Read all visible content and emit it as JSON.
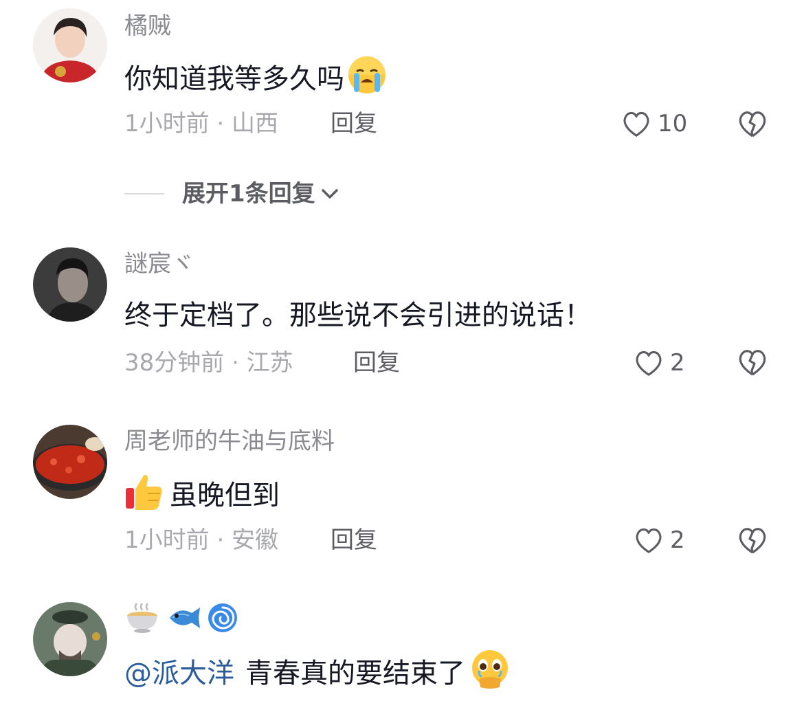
{
  "comments": [
    {
      "username": "橘贼",
      "content": "你知道我等多久吗",
      "content_emoji": "loudly-crying-face",
      "time": "1小时前",
      "location": "山西",
      "meta": "1小时前 · 山西",
      "reply_label": "回复",
      "likes": "10",
      "expand_label": "展开1条回复"
    },
    {
      "username": "謎宸ヾ",
      "content": "终于定档了。那些说不会引进的说话！",
      "time": "38分钟前",
      "location": "江苏",
      "meta": "38分钟前 · 江苏",
      "reply_label": "回复",
      "likes": "2"
    },
    {
      "username": "周老师的牛油与底料",
      "content_emoji": "thumbs-up",
      "content": "虽晚但到",
      "time": "1小时前",
      "location": "安徽",
      "meta": "1小时前 · 安徽",
      "reply_label": "回复",
      "likes": "2"
    },
    {
      "username_emojis": [
        "soup-bowl",
        "fish",
        "cyclone"
      ],
      "mention": "@派大洋",
      "content": "青春真的要结束了",
      "content_emoji": "pleading-face-hands"
    }
  ],
  "colors": {
    "username": "#8a8b91",
    "content": "#161823",
    "meta": "#a8a9ae",
    "action": "#5c5d63",
    "mention": "#2c5c9c"
  }
}
